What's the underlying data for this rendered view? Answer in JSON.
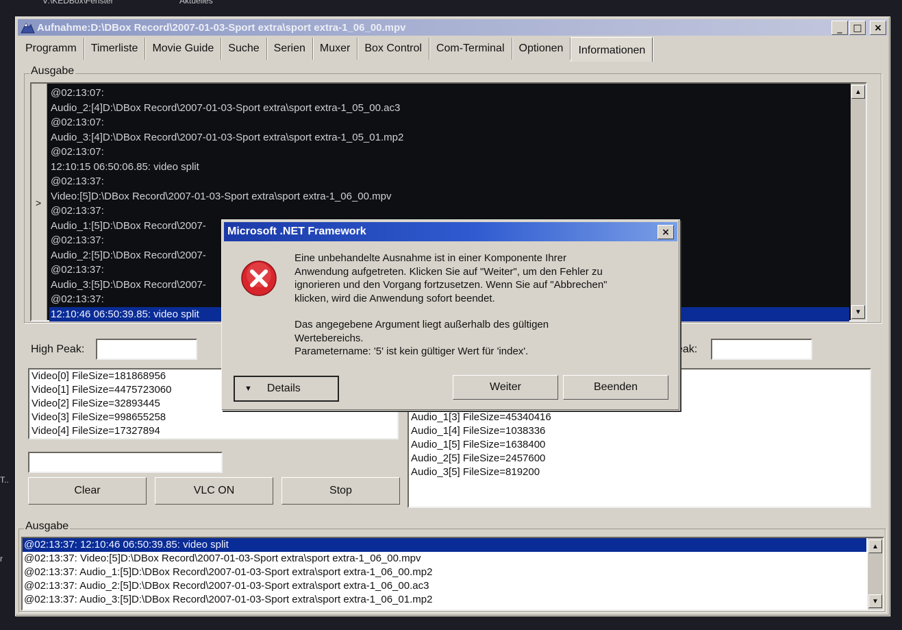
{
  "desktop": {
    "top_items": [
      "V:\\KEDBox\\Fenster",
      "Aktuelles"
    ],
    "left_labels": [
      "T..",
      "r"
    ]
  },
  "window": {
    "title": "Aufnahme:D:\\DBox Record\\2007-01-03-Sport extra\\sport extra-1_06_00.mpv",
    "controls": {
      "minimize": "_",
      "maximize": "□",
      "close": "×"
    }
  },
  "tabs": [
    {
      "label": "Programm"
    },
    {
      "label": "Timerliste"
    },
    {
      "label": "Movie Guide"
    },
    {
      "label": "Suche"
    },
    {
      "label": "Serien"
    },
    {
      "label": "Muxer"
    },
    {
      "label": "Box Control"
    },
    {
      "label": "Com-Terminal"
    },
    {
      "label": "Optionen"
    },
    {
      "label": "Informationen"
    }
  ],
  "ausgabe_top": {
    "label": "Ausgabe",
    "lines": [
      "@02:13:07:",
      "Audio_2:[4]D:\\DBox Record\\2007-01-03-Sport extra\\sport extra-1_05_00.ac3",
      "@02:13:07:",
      "Audio_3:[4]D:\\DBox Record\\2007-01-03-Sport extra\\sport extra-1_05_01.mp2",
      "@02:13:07:",
      "12:10:15 06:50:06.85: video split",
      "@02:13:37:",
      "Video:[5]D:\\DBox Record\\2007-01-03-Sport extra\\sport extra-1_06_00.mpv",
      "@02:13:37:",
      "Audio_1:[5]D:\\DBox Record\\2007-",
      "@02:13:37:",
      "Audio_2:[5]D:\\DBox Record\\2007-",
      "@02:13:37:",
      "Audio_3:[5]D:\\DBox Record\\2007-",
      "@02:13:37:",
      "12:10:46 06:50:39.85: video split"
    ],
    "gutter_marker": ">"
  },
  "high_peak": {
    "label": "High Peak:",
    "value": ""
  },
  "right_peak": {
    "label": "eak:",
    "value": ""
  },
  "video_list": [
    "Video[0] FileSize=181868956",
    "Video[1] FileSize=4475723060",
    "Video[2] FileSize=32893445",
    "Video[3] FileSize=998655258",
    "Video[4] FileSize=17327894"
  ],
  "audio_list": [
    "Audio_1[3] FileSize=45340416",
    "Audio_1[4] FileSize=1038336",
    "Audio_1[5] FileSize=1638400",
    "Audio_2[5] FileSize=2457600",
    "Audio_3[5] FileSize=819200"
  ],
  "small_input": {
    "value": ""
  },
  "buttons": {
    "clear": "Clear",
    "vlc": "VLC ON",
    "stop": "Stop"
  },
  "ausgabe_bottom": {
    "label": "Ausgabe",
    "lines": [
      "@02:13:37: 12:10:46 06:50:39.85: video split",
      "@02:13:37: Video:[5]D:\\DBox Record\\2007-01-03-Sport extra\\sport extra-1_06_00.mpv",
      "@02:13:37: Audio_1:[5]D:\\DBox Record\\2007-01-03-Sport extra\\sport extra-1_06_00.mp2",
      "@02:13:37: Audio_2:[5]D:\\DBox Record\\2007-01-03-Sport extra\\sport extra-1_06_00.ac3",
      "@02:13:37: Audio_3:[5]D:\\DBox Record\\2007-01-03-Sport extra\\sport extra-1_06_01.mp2"
    ]
  },
  "dialog": {
    "title": "Microsoft .NET Framework",
    "close": "×",
    "paragraph1": [
      "Eine unbehandelte Ausnahme ist in einer Komponente Ihrer",
      "Anwendung aufgetreten. Klicken Sie auf \"Weiter\", um den Fehler zu",
      "ignorieren und den Vorgang fortzusetzen. Wenn Sie auf \"Abbrechen\"",
      "klicken, wird die Anwendung sofort beendet."
    ],
    "paragraph2": [
      "Das angegebene Argument liegt außerhalb des gültigen",
      "Wertebereichs.",
      "Parametername: '5' ist kein gültiger Wert für 'index'."
    ],
    "details_label": "Details",
    "weiter_label": "Weiter",
    "beenden_label": "Beenden"
  },
  "colors": {
    "selection": "#0a2c96",
    "console_bg": "#0e0f13",
    "error_red": "#d8252c"
  }
}
